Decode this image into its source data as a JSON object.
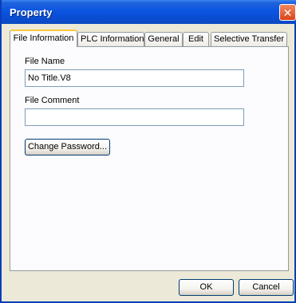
{
  "window": {
    "title": "Property"
  },
  "tabs": [
    {
      "label": "File Information",
      "active": true
    },
    {
      "label": "PLC Information",
      "active": false
    },
    {
      "label": "General",
      "active": false
    },
    {
      "label": "Edit",
      "active": false
    },
    {
      "label": "Selective Transfer",
      "active": false
    }
  ],
  "form": {
    "file_name_label": "File Name",
    "file_name_value": "No Title.V8",
    "file_comment_label": "File Comment",
    "file_comment_value": "",
    "change_password_label": "Change Password..."
  },
  "footer": {
    "ok_label": "OK",
    "cancel_label": "Cancel"
  },
  "colors": {
    "titlebar": "#0a4ed6",
    "dialog_bg": "#ece9d8",
    "active_tab_highlight": "#ffc83c"
  }
}
